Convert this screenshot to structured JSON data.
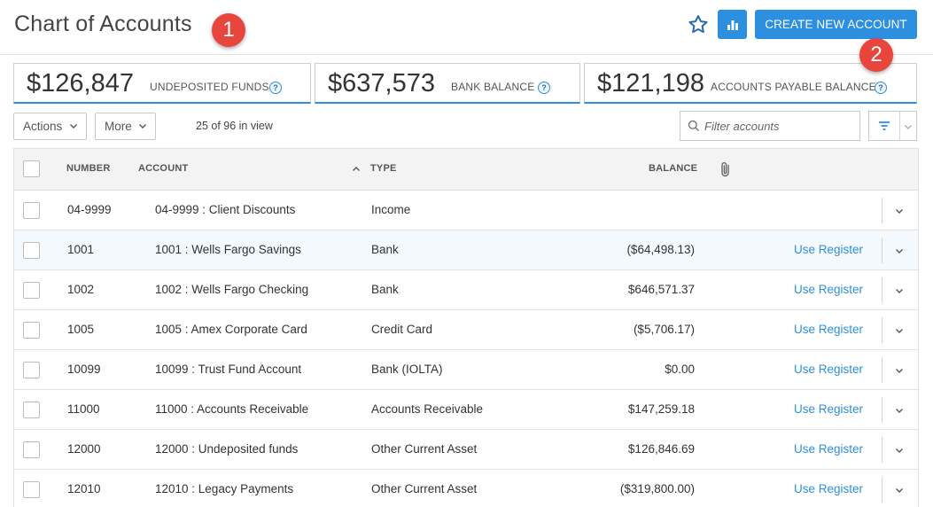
{
  "header": {
    "title": "Chart of Accounts",
    "create_label": "CREATE NEW ACCOUNT",
    "marker_1": "1",
    "marker_2": "2"
  },
  "stats": [
    {
      "amount": "$126,847",
      "label": "UNDEPOSITED FUNDS",
      "help": "?"
    },
    {
      "amount": "$637,573",
      "label": "BANK BALANCE",
      "help": "?"
    },
    {
      "amount": "$121,198",
      "label": "ACCOUNTS PAYABLE BALANCE",
      "help": "?"
    }
  ],
  "toolbar": {
    "actions_label": "Actions",
    "more_label": "More",
    "view_count": "25 of 96 in view",
    "filter_placeholder": "Filter accounts"
  },
  "table": {
    "columns": {
      "number": "NUMBER",
      "account": "ACCOUNT",
      "type": "TYPE",
      "balance": "BALANCE"
    },
    "sort_indicator": "^",
    "rows": [
      {
        "number": "04-9999",
        "account": "04-9999 : Client Discounts",
        "type": "Income",
        "balance": "",
        "action": ""
      },
      {
        "number": "1001",
        "account": "1001 : Wells Fargo Savings",
        "type": "Bank",
        "balance": "($64,498.13)",
        "action": "Use Register"
      },
      {
        "number": "1002",
        "account": "1002 : Wells Fargo Checking",
        "type": "Bank",
        "balance": "$646,571.37",
        "action": "Use Register"
      },
      {
        "number": "1005",
        "account": "1005 : Amex Corporate Card",
        "type": "Credit Card",
        "balance": "($5,706.17)",
        "action": "Use Register"
      },
      {
        "number": "10099",
        "account": "10099 : Trust Fund Account",
        "type": "Bank (IOLTA)",
        "balance": "$0.00",
        "action": "Use Register"
      },
      {
        "number": "11000",
        "account": "11000 : Accounts Receivable",
        "type": "Accounts Receivable",
        "balance": "$147,259.18",
        "action": "Use Register"
      },
      {
        "number": "12000",
        "account": "12000 : Undeposited funds",
        "type": "Other Current Asset",
        "balance": "$126,846.69",
        "action": "Use Register"
      },
      {
        "number": "12010",
        "account": "12010 : Legacy Payments",
        "type": "Other Current Asset",
        "balance": "($319,800.00)",
        "action": "Use Register"
      }
    ]
  },
  "colors": {
    "accent": "#2d8fe0",
    "marker": "#e8453c"
  },
  "icons": [
    "star-icon",
    "bar-chart-icon",
    "help-icon",
    "chevron-down-icon",
    "search-icon",
    "filter-icon",
    "paperclip-icon",
    "sort-asc-icon"
  ]
}
